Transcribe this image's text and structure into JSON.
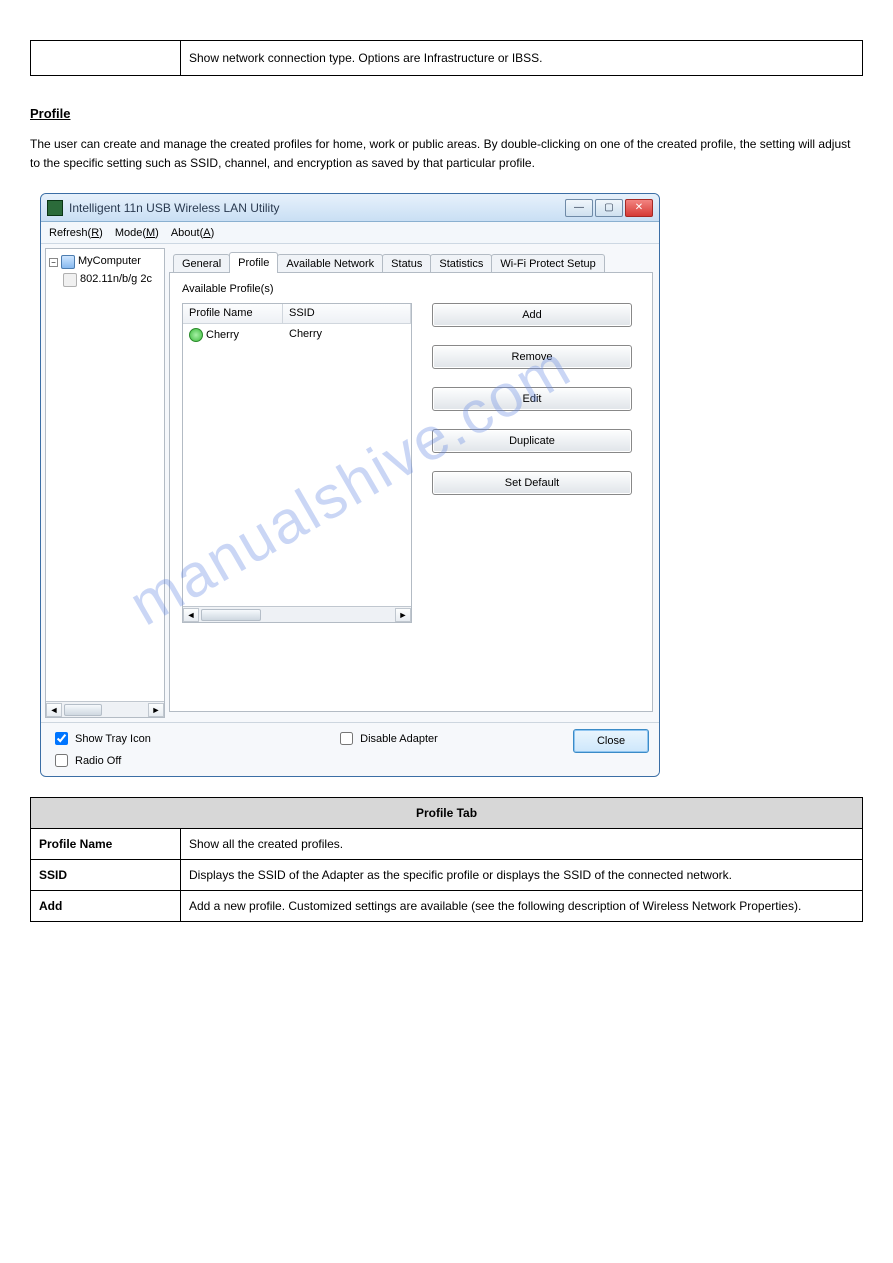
{
  "top_box": {
    "label": "",
    "desc": "Show network connection type. Options are Infrastructure or IBSS."
  },
  "section_heading": "Profile",
  "intro": "The user can create and manage the created profiles for home, work or public areas. By double-clicking on one of the created profile, the setting will adjust to the specific setting such as SSID, channel, and encryption as saved by that particular profile.",
  "window": {
    "title": "Intelligent 11n USB Wireless LAN Utility",
    "menus": [
      {
        "pre": "Refresh(",
        "u": "R",
        "post": ")"
      },
      {
        "pre": "Mode(",
        "u": "M",
        "post": ")"
      },
      {
        "pre": "About(",
        "u": "A",
        "post": ")"
      }
    ],
    "tree": {
      "root_label": "MyComputer",
      "child_label": "802.11n/b/g 2c"
    },
    "tabs": [
      "General",
      "Profile",
      "Available Network",
      "Status",
      "Statistics",
      "Wi-Fi Protect Setup"
    ],
    "active_tab": 1,
    "available_label": "Available Profile(s)",
    "list_headers": {
      "a": "Profile Name",
      "b": "SSID"
    },
    "list_rows": [
      {
        "name": "Cherry",
        "ssid": "Cherry"
      }
    ],
    "buttons": [
      "Add",
      "Remove",
      "Edit",
      "Duplicate",
      "Set Default"
    ],
    "checkboxes": {
      "show_tray": "Show Tray Icon",
      "radio_off": "Radio Off",
      "disable_adapter": "Disable Adapter"
    },
    "close_label": "Close",
    "watermark": "manualshive.com"
  },
  "profile_table": {
    "header": "Profile Tab",
    "rows": [
      {
        "k": "Profile Name",
        "v": "Show all the created profiles."
      },
      {
        "k": "SSID",
        "v": "Displays the SSID of the Adapter as the specific profile or displays the SSID of the connected network."
      },
      {
        "k": "Add",
        "v": "Add a new profile. Customized settings are available (see the following description of Wireless Network Properties)."
      }
    ]
  }
}
